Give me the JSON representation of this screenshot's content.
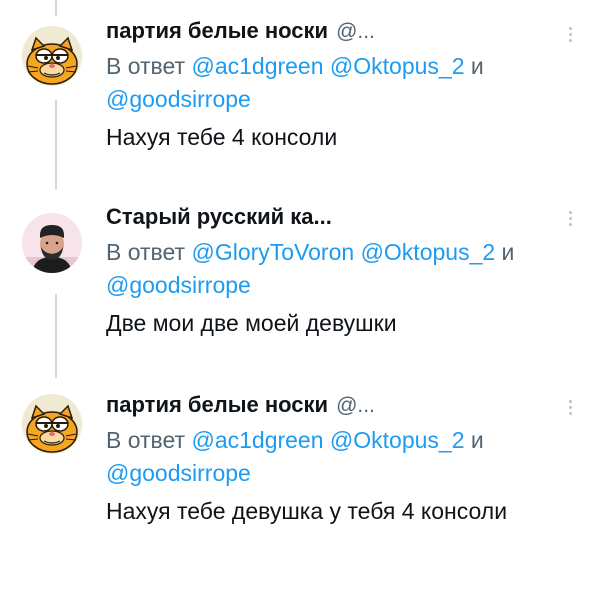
{
  "tweets": [
    {
      "author_name": "партия белые носки",
      "handle": "@...",
      "reply_prefix": "В ответ",
      "mentions": [
        "@ac1dgreen",
        "@Oktopus_2"
      ],
      "conjunction": "и",
      "last_mention": "@goodsirrope",
      "text": "Нахуя тебе 4 консоли",
      "avatar": "garfield-avatar-icon"
    },
    {
      "author_name": "Старый русский ка...",
      "handle": "",
      "reply_prefix": "В ответ",
      "mentions": [
        "@GloryToVoron",
        "@Oktopus_2"
      ],
      "conjunction": "и",
      "last_mention": "@goodsirrope",
      "text": "Две мои две моей девушки",
      "avatar": "man-photo-avatar-icon"
    },
    {
      "author_name": "партия белые носки",
      "handle": "@...",
      "reply_prefix": "В ответ",
      "mentions": [
        "@ac1dgreen",
        "@Oktopus_2"
      ],
      "conjunction": "и",
      "last_mention": "@goodsirrope",
      "text": "Нахуя тебе девушка у тебя 4 консоли",
      "avatar": "garfield-avatar-icon"
    }
  ],
  "colors": {
    "mention": "#1d9bf0",
    "secondary_text": "#536471",
    "primary_text": "#0f1419",
    "thread_line": "#cfd9de"
  }
}
